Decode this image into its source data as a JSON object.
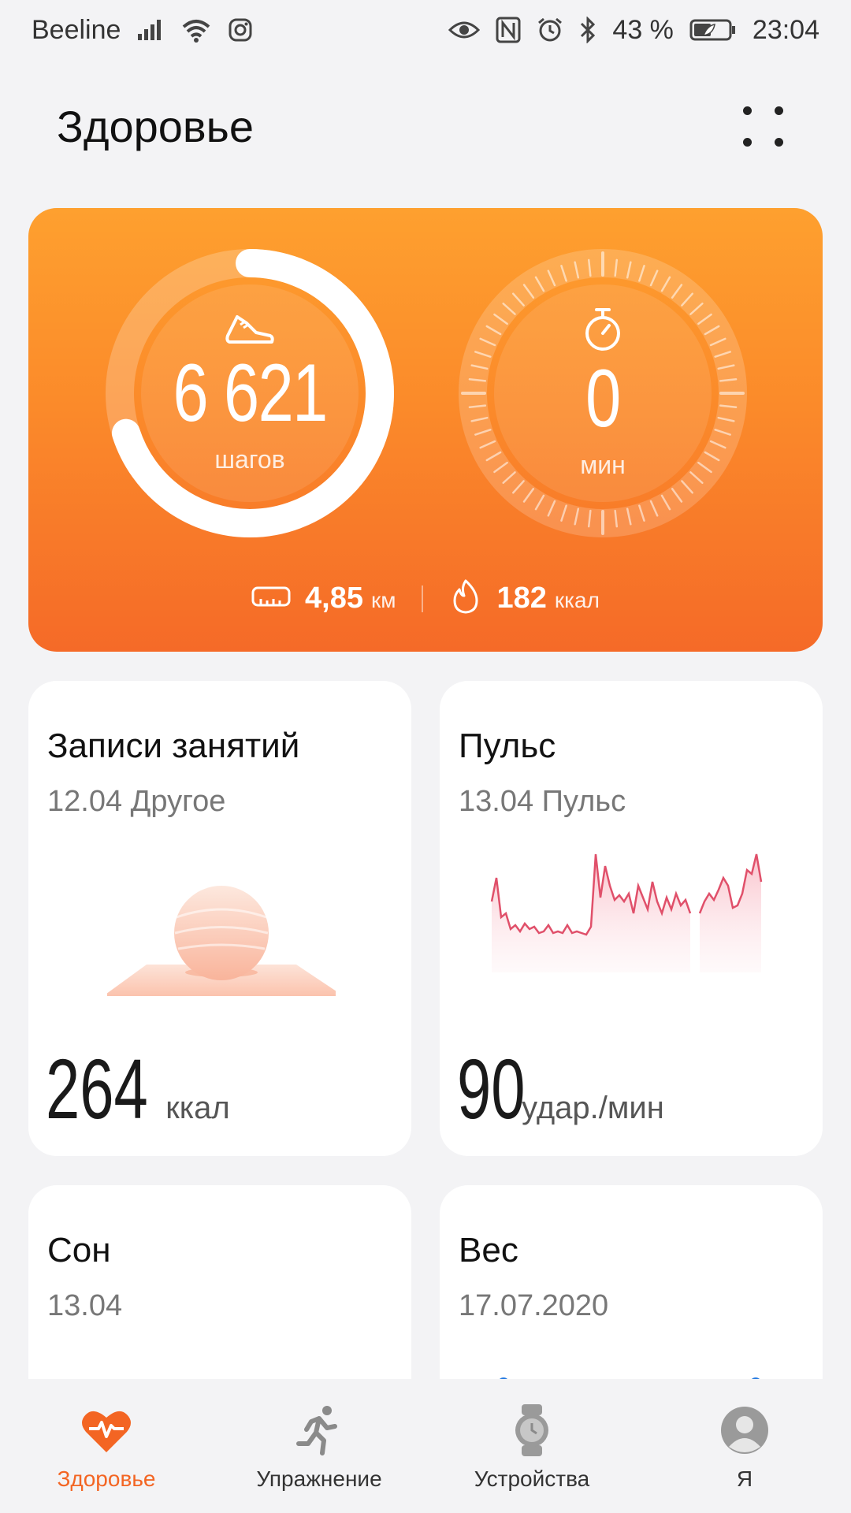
{
  "status": {
    "carrier": "Beeline",
    "battery": "43 %",
    "time": "23:04"
  },
  "header": {
    "title": "Здоровье"
  },
  "hero": {
    "steps": "6 621",
    "steps_unit": "шагов",
    "steps_progress": 0.7,
    "minutes": "0",
    "minutes_unit": "мин",
    "distance": "4,85",
    "distance_unit": "км",
    "calories": "182",
    "calories_unit": "ккал"
  },
  "cards": {
    "workouts": {
      "title": "Записи занятий",
      "subtitle": "12.04 Другое",
      "value": "264",
      "unit": "ккал"
    },
    "pulse": {
      "title": "Пульс",
      "subtitle": "13.04 Пульс",
      "value": "90",
      "unit": "удар./мин"
    },
    "sleep": {
      "title": "Сон",
      "subtitle": "13.04"
    },
    "weight": {
      "title": "Вес",
      "subtitle": "17.07.2020"
    }
  },
  "tabs": [
    {
      "label": "Здоровье",
      "icon": "heart-pulse-icon",
      "active": true
    },
    {
      "label": "Упражнение",
      "icon": "running-icon",
      "active": false
    },
    {
      "label": "Устройства",
      "icon": "watch-icon",
      "active": false
    },
    {
      "label": "Я",
      "icon": "avatar-icon",
      "active": false
    }
  ],
  "colors": {
    "accent": "#f36523",
    "hero_top": "#fea02f",
    "hero_bottom": "#f56a28",
    "pulse_line": "#e0506a"
  }
}
